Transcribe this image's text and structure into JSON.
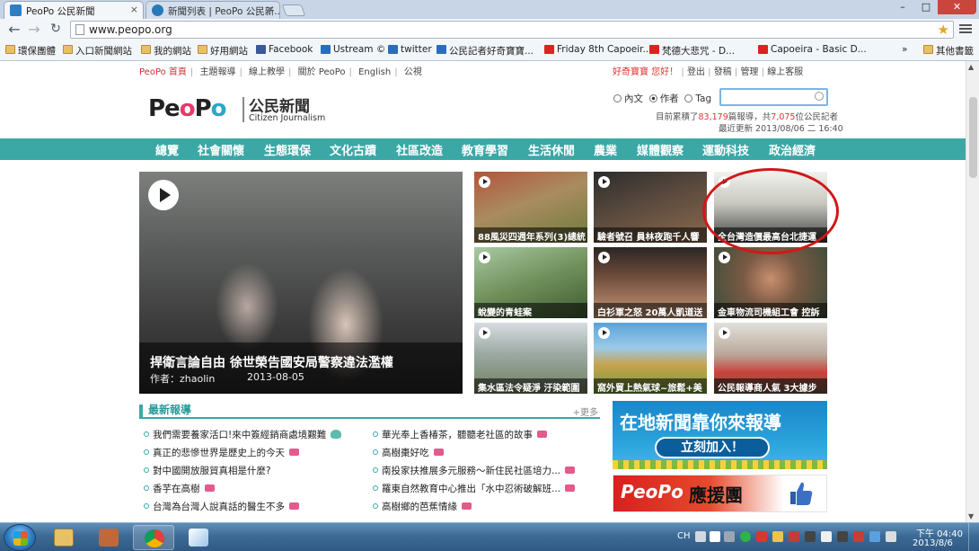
{
  "browser": {
    "tabs": [
      {
        "title": "PeoPo 公民新聞"
      },
      {
        "title": "新聞列表 | PeoPo 公民新..."
      }
    ],
    "url": "www.peopo.org",
    "bookmarks": [
      {
        "label": "環保團體",
        "icon": "folder-icon"
      },
      {
        "label": "入口新聞網站",
        "icon": "folder-icon"
      },
      {
        "label": "我的網站",
        "icon": "folder-icon"
      },
      {
        "label": "好用網站",
        "icon": "folder-icon"
      },
      {
        "label": "Facebook",
        "icon": "facebook-icon"
      },
      {
        "label": "Ustream ©",
        "icon": "ustream-icon"
      },
      {
        "label": "twitter",
        "icon": "ustream-icon"
      },
      {
        "label": "公民記者好奇寶寶...",
        "icon": "ustream-icon"
      },
      {
        "label": "Friday 8th Capoeir...",
        "icon": "youtube-icon"
      },
      {
        "label": "梵德大悲咒 - D...",
        "icon": "youtube-icon"
      },
      {
        "label": "Capoeira - Basic D...",
        "icon": "youtube-icon"
      },
      {
        "label": "其他書籤",
        "icon": "folder-icon"
      }
    ],
    "more_bookmarks": "»"
  },
  "site": {
    "topnav": [
      "PeoPo 首頁",
      "主題報導",
      "線上教學",
      "關於 PeoPo",
      "English",
      "公視"
    ],
    "usernav": {
      "greeting": "好奇寶寶 您好！",
      "links": [
        "登出",
        "發稿",
        "管理",
        "線上客服"
      ]
    },
    "logo": {
      "brand": "PeoPo",
      "title_cn": "公民新聞",
      "title_en": "Citizen Journalism"
    },
    "search": {
      "options": [
        "內文",
        "作者",
        "Tag"
      ],
      "selected": "作者",
      "value": ""
    },
    "stats": {
      "prefix": "目前累積了",
      "reports": "83,179",
      "middle": "篇報導，共",
      "reporters": "7,075",
      "suffix": "位公民記者",
      "updated": "最近更新 2013/08/06 二 16:40"
    },
    "categories": [
      "總覽",
      "社會關懷",
      "生態環保",
      "文化古蹟",
      "社區改造",
      "教育學習",
      "生活休閒",
      "農業",
      "媒體觀察",
      "運動科技",
      "政治經濟"
    ],
    "hero": {
      "title": "捍衛言論自由 徐世榮告國安局警察違法濫權",
      "author": "作者：zhaolin",
      "date": "2013-08-05"
    },
    "thumbs": [
      {
        "caption": "88風災四週年系列(3)總統"
      },
      {
        "caption": "驗者號召 員林夜跑千人響"
      },
      {
        "caption": "全台灣造價最高台北捷運"
      },
      {
        "caption": "蛻變的青蛙案"
      },
      {
        "caption": "白衫軍之怒 20萬人凱道送"
      },
      {
        "caption": "金車物流司機組工會 控訴"
      },
      {
        "caption": "集水區法令疑淨 汙染範圍"
      },
      {
        "caption": "窩外貿上熱氣球~旅鬆+美"
      },
      {
        "caption": "公民報導商人氣 3大據步"
      }
    ],
    "news": {
      "heading": "最新報導",
      "more": "+更多",
      "left": [
        {
          "text": "我們需要養家活口!來中簽經銷商處境艱難",
          "tag": "people"
        },
        {
          "text": "真正的悲慘世界是歷史上的今天",
          "tag": "video"
        },
        {
          "text": "對中國開放服貿真相是什麼?",
          "tag": ""
        },
        {
          "text": "香芋在高樹",
          "tag": "video"
        },
        {
          "text": "台灣為台灣人說真話的醫生不多",
          "tag": "video"
        }
      ],
      "right": [
        {
          "text": "華光奉上香椿茶，聽聽老社區的故事",
          "tag": "video"
        },
        {
          "text": "高樹棗好吃",
          "tag": "video"
        },
        {
          "text": "南投家扶推展多元服務～新住民社區培力...",
          "tag": "video"
        },
        {
          "text": "羅東自然教育中心推出「水中忍術破解班...",
          "tag": "video"
        },
        {
          "text": "高樹鄉的芭蕉情緣",
          "tag": "video"
        }
      ]
    },
    "ads": {
      "recruit_line": "在地新聞靠你來報導",
      "recruit_button": "立刻加入！",
      "support_brand": "PeoPo",
      "support_text": "應援團"
    }
  },
  "taskbar": {
    "lang": "CH",
    "time": "下午 04:40",
    "date": "2013/8/6"
  }
}
